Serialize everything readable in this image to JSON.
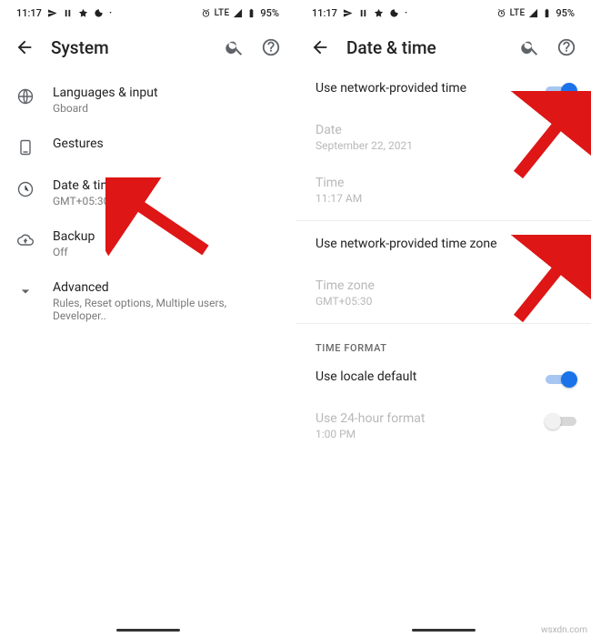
{
  "status": {
    "time": "11:17",
    "lte": "LTE",
    "battery": "95%"
  },
  "left": {
    "title": "System",
    "items": {
      "lang": {
        "title": "Languages & input",
        "sub": "Gboard"
      },
      "gestures": {
        "title": "Gestures"
      },
      "datetime": {
        "title": "Date & time",
        "sub": "GMT+05:30"
      },
      "backup": {
        "title": "Backup",
        "sub": "Off"
      },
      "advanced": {
        "title": "Advanced",
        "sub": "Rules, Reset options, Multiple users, Developer.."
      }
    }
  },
  "right": {
    "title": "Date & time",
    "rows": {
      "network_time": {
        "title": "Use network-provided time"
      },
      "date": {
        "title": "Date",
        "sub": "September 22, 2021"
      },
      "time": {
        "title": "Time",
        "sub": "11:17 AM"
      },
      "network_tz": {
        "title": "Use network-provided time zone"
      },
      "tz": {
        "title": "Time zone",
        "sub": "GMT+05:30"
      },
      "section": "TIME FORMAT",
      "locale": {
        "title": "Use locale default"
      },
      "h24": {
        "title": "Use 24-hour format",
        "sub": "1:00 PM"
      }
    }
  },
  "watermark": "wsxdn.com"
}
